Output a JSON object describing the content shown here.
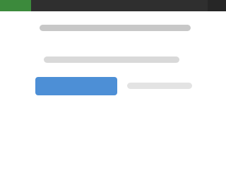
{
  "app": {
    "header": {
      "brand_color": "#3c8a3c",
      "bar_color": "#2f2f2f"
    },
    "content": {
      "line_1": "",
      "line_2": ""
    },
    "actions": {
      "primary_label": "",
      "primary_color": "#4d8fd6",
      "secondary_label": ""
    }
  }
}
